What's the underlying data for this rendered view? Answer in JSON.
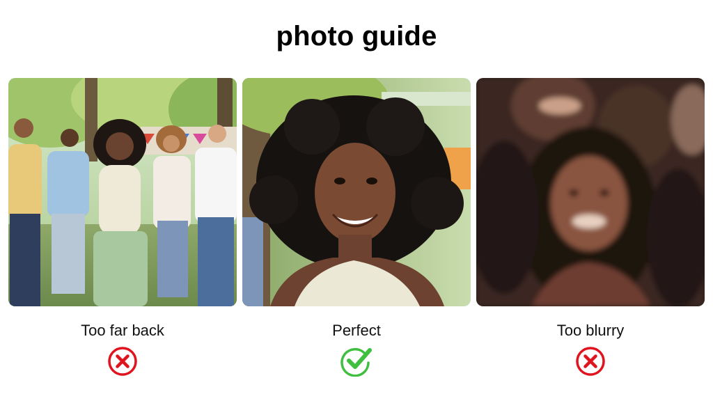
{
  "title": "photo guide",
  "examples": [
    {
      "caption": "Too far back",
      "status": "rejected",
      "status_icon": "x-circle-icon",
      "status_color": "#e0141e",
      "photo_subject": "group-of-people-far-away"
    },
    {
      "caption": "Perfect",
      "status": "accepted",
      "status_icon": "check-circle-icon",
      "status_color": "#3fbf3f",
      "photo_subject": "close-up-smiling-portrait"
    },
    {
      "caption": "Too blurry",
      "status": "rejected",
      "status_icon": "x-circle-icon",
      "status_color": "#e0141e",
      "photo_subject": "blurry-dark-portrait"
    }
  ]
}
